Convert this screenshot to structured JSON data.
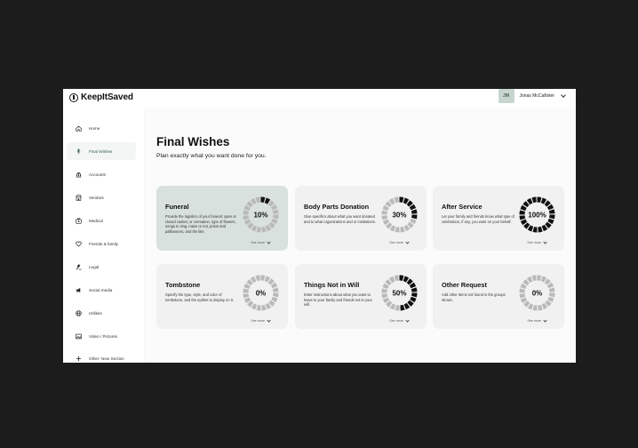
{
  "brand": {
    "name": "KeepItSaved"
  },
  "user": {
    "initials": "JM",
    "name": "Jonas McCallister"
  },
  "sidebar": {
    "items": [
      {
        "label": "Home",
        "icon": "home-icon",
        "active": false
      },
      {
        "label": "Final Wishes",
        "icon": "microphone-icon",
        "active": true
      },
      {
        "label": "Accounts",
        "icon": "bank-icon",
        "active": false
      },
      {
        "label": "Vendors",
        "icon": "shop-icon",
        "active": false
      },
      {
        "label": "Medical",
        "icon": "medical-icon",
        "active": false
      },
      {
        "label": "Friends & family",
        "icon": "heart-icon",
        "active": false
      },
      {
        "label": "Legal",
        "icon": "gavel-icon",
        "active": false
      },
      {
        "label": "Social media",
        "icon": "megaphone-icon",
        "active": false
      },
      {
        "label": "Utilities",
        "icon": "globe-icon",
        "active": false
      },
      {
        "label": "Video / Pictures",
        "icon": "image-icon",
        "active": false
      },
      {
        "label": "Other: New Section",
        "icon": "plus-icon",
        "active": false
      }
    ]
  },
  "page": {
    "title": "Final Wishes",
    "subtitle": "Plan exactly what you want done for you."
  },
  "cards": [
    {
      "title": "Funeral",
      "description": "Provide the logistics of your funeral: open or closed casket, or cremation, type of flowers, songs to sing, mass or not, priest and pallbearers, and the like.",
      "percent_label": "10%",
      "progress": 0.1,
      "see_more": "See more",
      "highlight": true
    },
    {
      "title": "Body Parts Donation",
      "description": "Give specifics about what you want donated and to what organizations and or institutions.",
      "percent_label": "30%",
      "progress": 0.3,
      "see_more": "See more",
      "highlight": false
    },
    {
      "title": "After Service",
      "description": "Let your family and friends know what type of celebration, if any, you want on your behalf.",
      "percent_label": "100%",
      "progress": 1.0,
      "see_more": "See more",
      "highlight": false
    },
    {
      "title": "Tombstone",
      "description": "Specify the type, style, and color of tombstone, and the epithet to display on it.",
      "percent_label": "0%",
      "progress": 0.0,
      "see_more": "See more",
      "highlight": false
    },
    {
      "title": "Things Not in Will",
      "description": "Enter instructions about what you want to leave to your family and friends not in your will.",
      "percent_label": "50%",
      "progress": 0.5,
      "see_more": "See more",
      "highlight": false
    },
    {
      "title": "Other Request",
      "description": "Add other items not found in the groups shown.",
      "percent_label": "0%",
      "progress": 0.0,
      "see_more": "See more",
      "highlight": false
    }
  ],
  "colors": {
    "ring_filled": "#111111",
    "ring_empty": "#b9b9b9",
    "card_bg": "#f1f1f1",
    "card_highlight_bg": "#d8e1dd",
    "active_text": "#2f5b4a"
  }
}
